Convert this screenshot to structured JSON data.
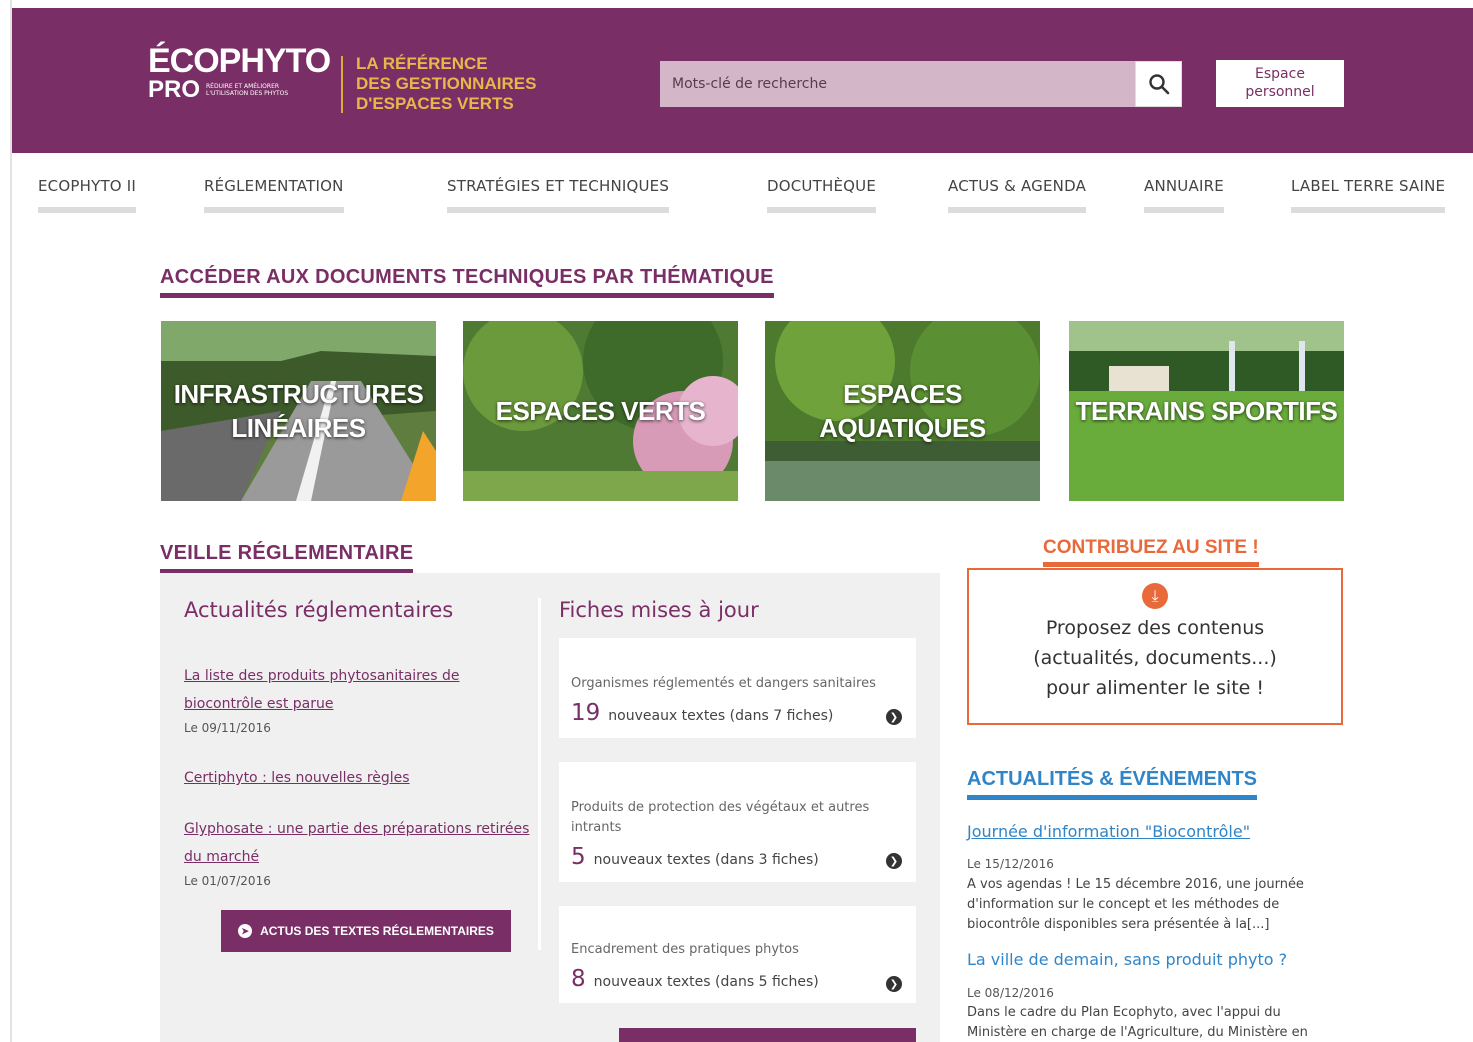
{
  "header": {
    "logo_line1": "ÉCOPHYTO",
    "logo_pro": "PRO",
    "logo_small": "RÉDUIRE ET AMÉLIORER L'UTILISATION DES PHYTOS",
    "tagline_1": "LA RÉFÉRENCE",
    "tagline_2": "DES GESTIONNAIRES",
    "tagline_3": "D'ESPACES VERTS",
    "search_placeholder": "Mots-clé de recherche",
    "espace_line1": "Espace",
    "espace_line2": "personnel",
    "colors": {
      "brand": "#7a2e66",
      "accent": "#e9b64a"
    }
  },
  "nav": {
    "items": [
      {
        "label": "ECOPHYTO II"
      },
      {
        "label": "RÉGLEMENTATION"
      },
      {
        "label": "STRATÉGIES ET TECHNIQUES"
      },
      {
        "label": "DOCUTHÈQUE"
      },
      {
        "label": "ACTUS & AGENDA"
      },
      {
        "label": "ANNUAIRE"
      },
      {
        "label": "LABEL TERRE SAINE"
      }
    ]
  },
  "themes": {
    "title": "ACCÉDER AUX DOCUMENTS TECHNIQUES PAR THÉMATIQUE",
    "tiles": [
      {
        "line1": "INFRASTRUCTURES",
        "line2": "LINÉAIRES"
      },
      {
        "line1": "ESPACES VERTS"
      },
      {
        "line1": "ESPACES AQUATIQUES"
      },
      {
        "line1": "TERRAINS SPORTIFS"
      }
    ]
  },
  "veille": {
    "title": "VEILLE RÉGLEMENTAIRE",
    "actus_title": "Actualités réglementaires",
    "actus": [
      {
        "title": "La liste des produits phytosanitaires de biocontrôle est parue",
        "date": "Le 09/11/2016"
      },
      {
        "title": "Certiphyto : les nouvelles règles"
      },
      {
        "title": "Glyphosate : une partie des préparations retirées du marché",
        "date": "Le 01/07/2016"
      }
    ],
    "actus_button": "ACTUS DES TEXTES RÉGLEMENTAIRES",
    "fiches_title": "Fiches mises à jour",
    "fiches": [
      {
        "category": "Organismes réglementés et dangers sanitaires",
        "count": "19",
        "text_a": "nouveaux textes (dans",
        "sheets": "7",
        "text_b": "fiches)"
      },
      {
        "category": "Produits de protection des végétaux et autres intrants",
        "count": "5",
        "text_a": "nouveaux textes (dans",
        "sheets": "3",
        "text_b": "fiches)"
      },
      {
        "category": "Encadrement des pratiques phytos",
        "count": "8",
        "text_a": "nouveaux textes (dans",
        "sheets": "5",
        "text_b": "fiches)"
      }
    ]
  },
  "contrib": {
    "title": "CONTRIBUEZ AU SITE !",
    "line1": "Proposez des contenus",
    "line2": "(actualités, documents...)",
    "line3": "pour alimenter le site !"
  },
  "events": {
    "title": "ACTUALITÉS & ÉVÉNEMENTS",
    "items": [
      {
        "title": "Journée d'information \"Biocontrôle\"",
        "date": "Le 15/12/2016",
        "desc": "A vos agendas ! Le 15 décembre 2016, une journée d'information sur le concept et les méthodes de biocontrôle disponibles sera présentée à la[...]"
      },
      {
        "title": "La ville de demain, sans produit phyto ?",
        "date": "Le 08/12/2016",
        "desc": "Dans le cadre du Plan Ecophyto, avec l'appui du Ministère en charge de l'Agriculture, du Ministère en"
      }
    ]
  }
}
